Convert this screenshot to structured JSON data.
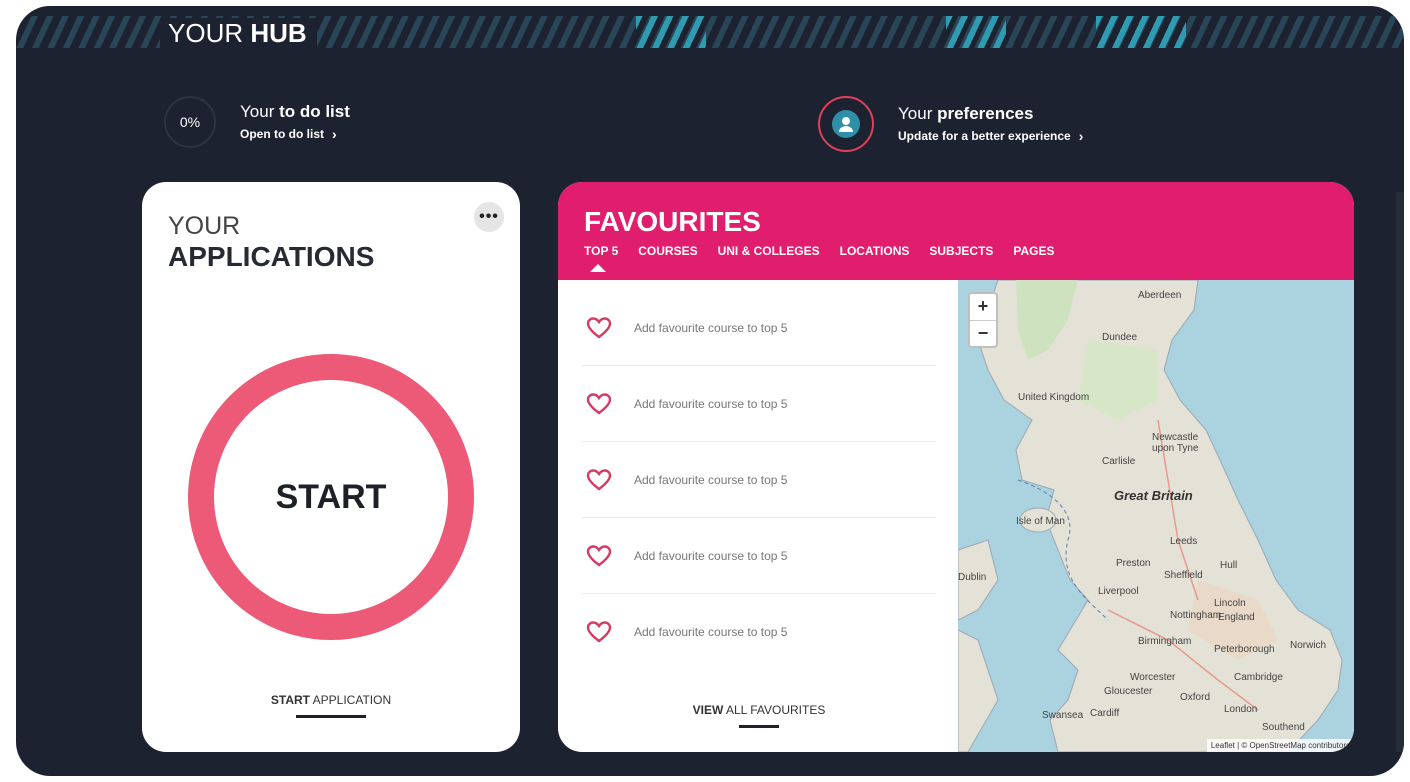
{
  "hub": {
    "title_prefix": "YOUR ",
    "title_bold": "HUB"
  },
  "todo": {
    "percent": "0%",
    "title_prefix": "Your ",
    "title_bold": "to do list",
    "link": "Open to do list",
    "chevron": "›"
  },
  "preferences": {
    "title_prefix": "Your ",
    "title_bold": "preferences",
    "link": "Update for a better experience",
    "chevron": "›",
    "icon": "user-icon"
  },
  "applications": {
    "title_line1": "YOUR",
    "title_line2": "APPLICATIONS",
    "menu_label": "•••",
    "start_label": "START",
    "footer_bold": "START",
    "footer_rest": " APPLICATION"
  },
  "favourites": {
    "title": "FAVOURITES",
    "tabs": [
      "TOP 5",
      "COURSES",
      "UNI & COLLEGES",
      "LOCATIONS",
      "SUBJECTS",
      "PAGES"
    ],
    "items": [
      "Add favourite course to top 5",
      "Add favourite course to top 5",
      "Add favourite course to top 5",
      "Add favourite course to top 5",
      "Add favourite course to top 5"
    ],
    "footer_bold": "VIEW",
    "footer_rest": " ALL FAVOURITES"
  },
  "map": {
    "zoom_in": "+",
    "zoom_out": "−",
    "labels": {
      "aberdeen": "Aberdeen",
      "dundee": "Dundee",
      "uk": "United Kingdom",
      "newcastle": "Newcastle upon Tyne",
      "carlisle": "Carlisle",
      "great_britain": "Great Britain",
      "isle_of_man": "Isle of Man",
      "leeds": "Leeds",
      "preston": "Preston",
      "hull": "Hull",
      "sheffield": "Sheffield",
      "dublin": "Dublin",
      "liverpool": "Liverpool",
      "nottingham": "Nottingham",
      "lincoln": "Lincoln",
      "england": "England",
      "birmingham": "Birmingham",
      "peterborough": "Peterborough",
      "norwich": "Norwich",
      "worcester": "Worcester",
      "cambridge": "Cambridge",
      "gloucester": "Gloucester",
      "oxford": "Oxford",
      "swansea": "Swansea",
      "cardiff": "Cardiff",
      "london": "London",
      "southend": "Southend"
    },
    "attribution": "Leaflet | © OpenStreetMap contributors"
  },
  "colors": {
    "background": "#1d2230",
    "accent_pink": "#e01e6d",
    "start_ring": "#ec5a77",
    "teal": "#2f8ea8"
  }
}
